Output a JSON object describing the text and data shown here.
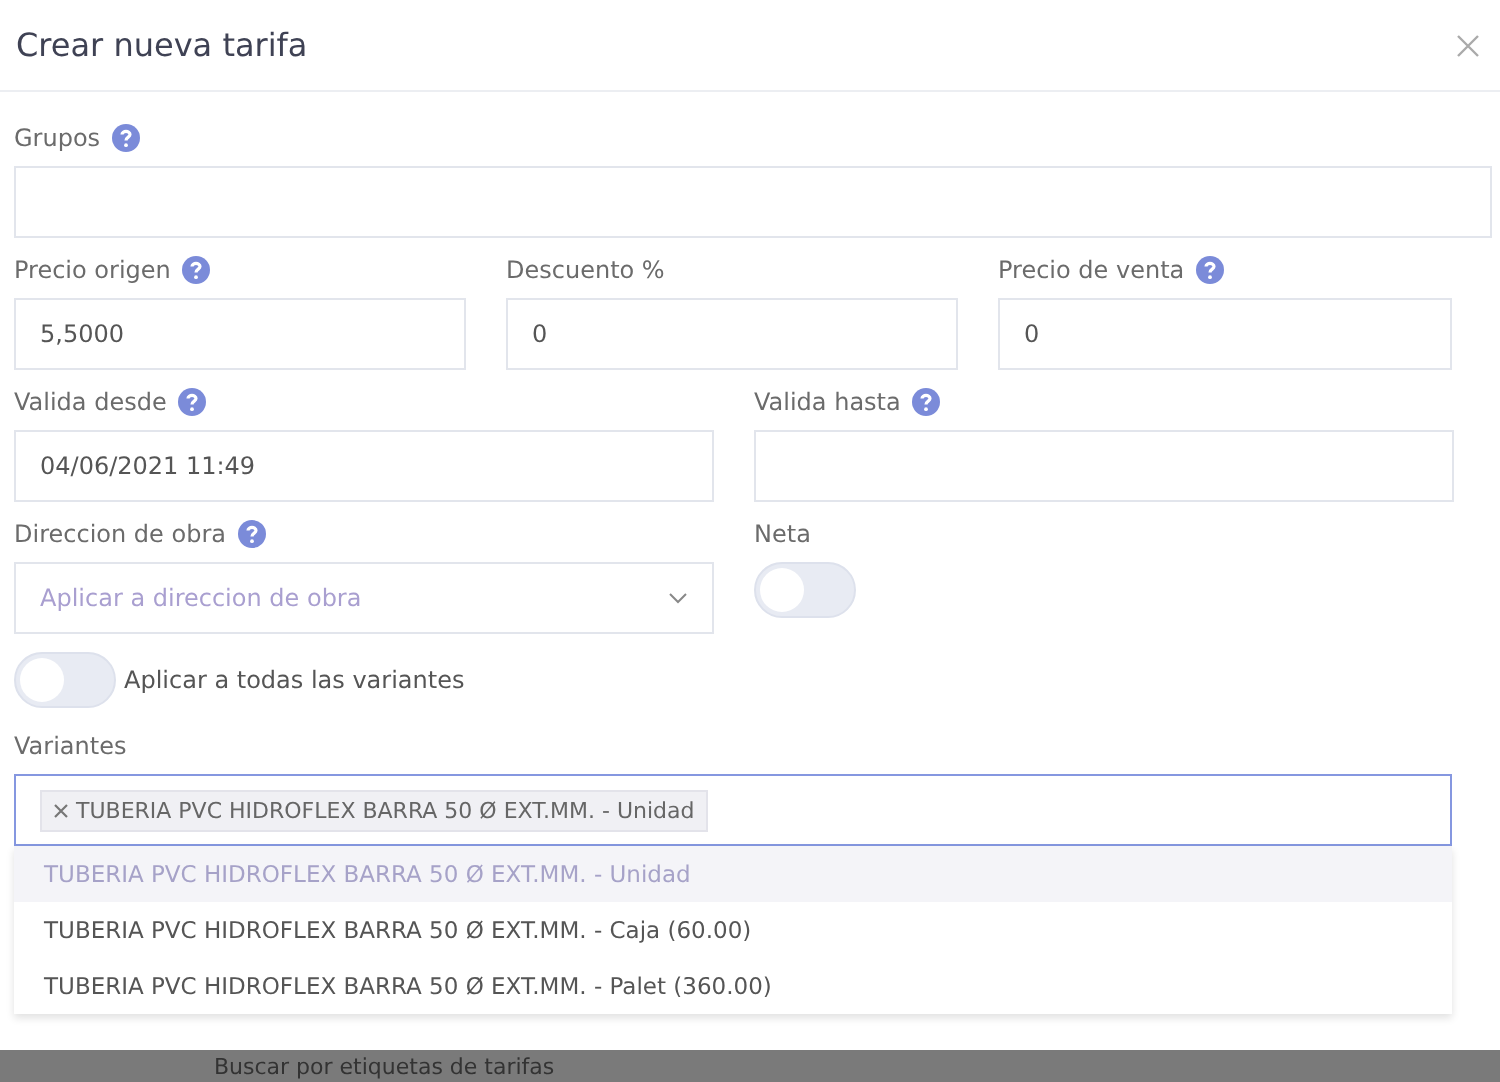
{
  "dialog": {
    "title": "Crear nueva tarifa"
  },
  "rows": [
    [
      {
        "kind": "text",
        "label": "Grupos",
        "help": true
      }
    ],
    [
      {
        "kind": "text",
        "label": "Precio origen",
        "help": true,
        "value": "5,5000"
      },
      {
        "kind": "text",
        "label": "Descuento %",
        "help": false,
        "value": "0"
      },
      {
        "kind": "text",
        "label": "Precio de venta",
        "help": true,
        "value": "0"
      }
    ],
    [
      {
        "kind": "text",
        "label": "Valida desde",
        "help": true,
        "value": "04/06/2021 11:49"
      },
      {
        "kind": "text",
        "label": "Valida hasta",
        "help": true
      }
    ],
    [
      {
        "kind": "select",
        "label": "Direccion de obra",
        "help": true,
        "placeholder": "Aplicar a direccion de obra"
      },
      {
        "kind": "toggle",
        "label": "Neta",
        "help": false,
        "on": false
      }
    ]
  ],
  "apply_all": {
    "label": "Aplicar a todas las variantes",
    "on": false
  },
  "variants": {
    "label": "Variantes",
    "tags": [
      "TUBERIA PVC HIDROFLEX BARRA 50 Ø EXT.MM. - Unidad"
    ],
    "options": [
      {
        "label": "TUBERIA PVC HIDROFLEX BARRA 50 Ø EXT.MM. - Unidad",
        "selected": true
      },
      {
        "label": "TUBERIA PVC HIDROFLEX BARRA 50 Ø EXT.MM. - Caja (60.00)",
        "selected": false
      },
      {
        "label": "TUBERIA PVC HIDROFLEX BARRA 50 Ø EXT.MM. - Palet (360.00)",
        "selected": false
      }
    ]
  },
  "background_text": "Buscar por etiquetas de tarifas"
}
